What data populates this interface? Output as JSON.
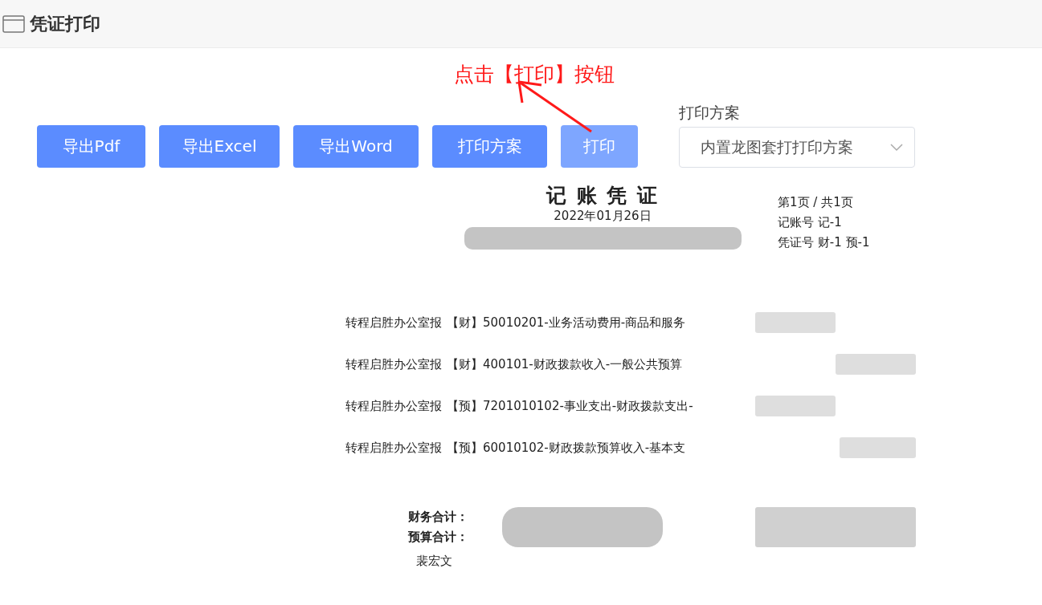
{
  "page": {
    "title": "凭证打印"
  },
  "annotation": {
    "text": "点击【打印】按钮"
  },
  "toolbar": {
    "buttons": [
      {
        "label": "导出Pdf",
        "highlighted": false
      },
      {
        "label": "导出Excel",
        "highlighted": false
      },
      {
        "label": "导出Word",
        "highlighted": false
      },
      {
        "label": "打印方案",
        "highlighted": false
      },
      {
        "label": "打印",
        "highlighted": true
      }
    ],
    "scheme_select": {
      "label": "打印方案",
      "value": "内置龙图套打打印方案"
    }
  },
  "voucher": {
    "title": "记 账 凭 证",
    "date": "2022年01月26日",
    "page_info": "第1页 / 共1页",
    "record_no_label": "记账号",
    "record_no": "记-1",
    "voucher_no_label": "凭证号",
    "voucher_no": "财-1 预-1",
    "rows": [
      {
        "summary": "转程启胜办公室报",
        "account": "【财】50010201-业务活动费用-商品和服务"
      },
      {
        "summary": "转程启胜办公室报",
        "account": "【财】400101-财政拨款收入-一般公共预算"
      },
      {
        "summary": "转程启胜办公室报",
        "account": "【预】7201010102-事业支出-财政拨款支出-"
      },
      {
        "summary": "转程启胜办公室报",
        "account": "【预】60010102-财政拨款预算收入-基本支"
      }
    ],
    "totals": [
      {
        "label": "财务合计："
      },
      {
        "label": "预算合计："
      }
    ],
    "signer": "裴宏文"
  }
}
